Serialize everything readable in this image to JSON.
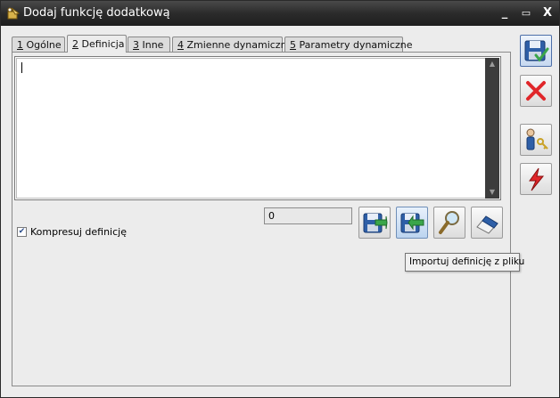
{
  "window": {
    "title": "Dodaj funkcję dodatkową",
    "controls": {
      "minimize": "_",
      "maximize": "▭",
      "close": "X"
    }
  },
  "tabs": [
    {
      "key": "1",
      "label": " Ogólne"
    },
    {
      "key": "2",
      "label": " Definicja",
      "active": true
    },
    {
      "key": "3",
      "label": " Inne"
    },
    {
      "key": "4",
      "label": " Zmienne dynamiczne"
    },
    {
      "key": "5",
      "label": " Parametry dynamiczne"
    }
  ],
  "definition": {
    "text": "",
    "counter_value": "0",
    "compress_label": "Kompresuj definicję",
    "compress_checked": true,
    "tooltip": "Importuj definicję z pliku"
  },
  "colors": {
    "titlebar": "#2b2b2b",
    "accent_blue": "#2e5fa7",
    "cancel_red": "#e0262a",
    "accent_green": "#3aa64a"
  }
}
